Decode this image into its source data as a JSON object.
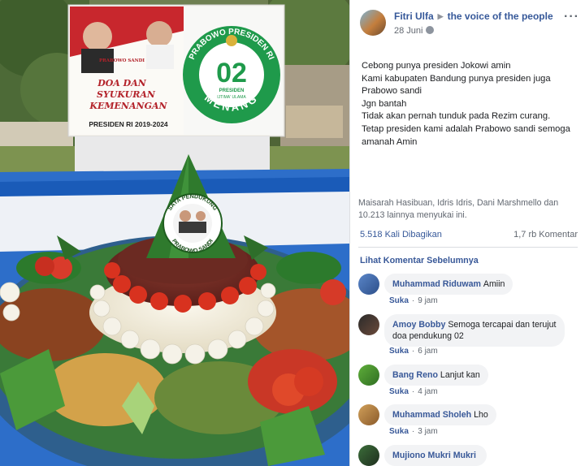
{
  "post": {
    "author": "Fitri Ulfa",
    "target_page": "the voice of the people",
    "date": "28 Juni",
    "more_label": "···",
    "text_lines": [
      "Cebong punya presiden Jokowi amin",
      "Kami kabupaten Bandung punya presiden juga",
      "Prabowo sandi",
      "Jgn bantah",
      "Tidak akan pernah tunduk pada Rezim curang.",
      "Tetap presiden kami adalah Prabowo sandi semoga",
      "amanah Amin"
    ],
    "likes_text": "Maisarah Hasibuan, Idris Idris, Dani Marshmello dan 10.213 lainnya menyukai ini.",
    "shares": "5.518 Kali Dibagikan",
    "comments_count": "1,7 rb Komentar",
    "prev_comments_label": "Lihat Komentar Sebelumnya"
  },
  "photo": {
    "banner": {
      "left_title_1": "DOA DAN",
      "left_title_2": "SYUKURAN",
      "left_title_3": "KEMENANGAN",
      "left_footer": "PRESIDEN RI 2019-2024",
      "small_label": "PRABOWO SANDI",
      "ring_top": "PRABOWO PRESIDEN RI",
      "ring_bottom": "MENANG",
      "center_number": "02",
      "center_sub": "PRESIDEN",
      "center_sub2": "IJTIMA' ULAMA"
    },
    "cone": {
      "top_text": "SAYA PENDUKUNG",
      "bottom_text": "PRABOWO SANDI"
    }
  },
  "comments": [
    {
      "name": "Muhammad Riduwam",
      "text": "Amiin",
      "like": "Suka",
      "time": "9 jam"
    },
    {
      "name": "Amoy Bobby",
      "text": "Semoga tercapai dan terujut",
      "text2": "doa pendukung 02",
      "like": "Suka",
      "time": "6 jam"
    },
    {
      "name": "Bang Reno",
      "text": "Lanjut kan",
      "like": "Suka",
      "time": "4 jam"
    },
    {
      "name": "Muhammad Sholeh",
      "text": "Lho",
      "like": "Suka",
      "time": "3 jam"
    },
    {
      "name": "Mujiono Mukri Mukri",
      "text": ""
    }
  ],
  "colors": {
    "link": "#365899",
    "bubble": "#f2f3f5",
    "banner_green": "#1f9a4b",
    "banner_red": "#c8272d",
    "table_blue": "#1d6fd1"
  }
}
